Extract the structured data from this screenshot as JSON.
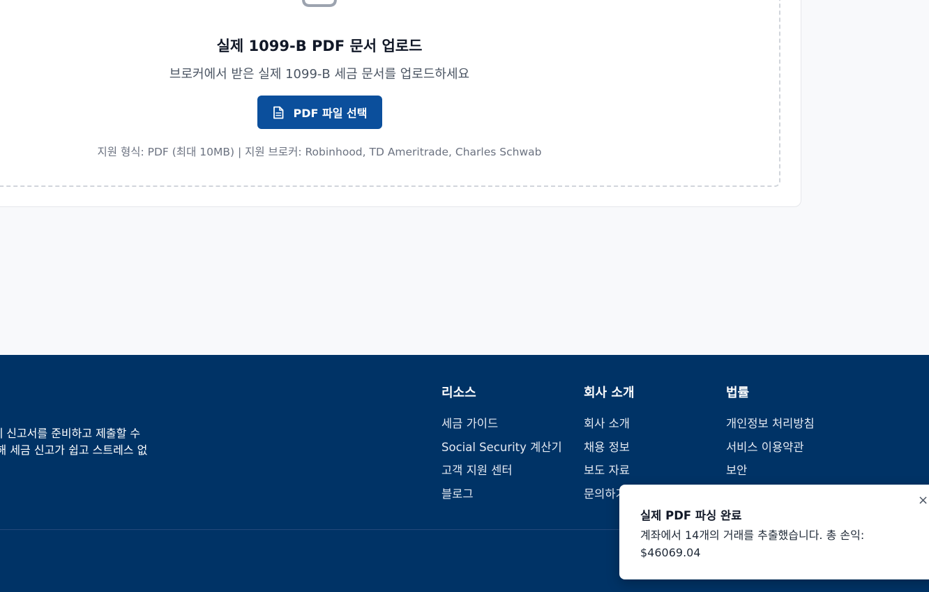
{
  "upload": {
    "title": "실제 1099-B PDF 문서 업로드",
    "subtitle": "브로커에서 받은 실제 1099-B 세금 문서를 업로드하세요",
    "button_label": "PDF 파일 선택",
    "formats": "지원 형식: PDF (최대 10MB) | 지원 브로커: Robinhood, TD Ameritrade, Charles Schwab",
    "icon": "upload-icon",
    "button_icon": "document-icon",
    "accent": "#0b4f9c"
  },
  "footer": {
    "about_lines": [
      "연방세 신고서를 준비하고 제출할 수",
      "을 통해 세금 신고가 쉽고 스트레스 없"
    ],
    "background": "#003366",
    "columns": [
      {
        "heading": "리소스",
        "links": [
          "세금 가이드",
          "Social Security 계산기",
          "고객 지원 센터",
          "블로그"
        ]
      },
      {
        "heading": "회사 소개",
        "links": [
          "회사 소개",
          "채용 정보",
          "보도 자료",
          "문의하기"
        ]
      },
      {
        "heading": "법률",
        "links": [
          "개인정보 처리방침",
          "서비스 이용약관",
          "보안"
        ]
      }
    ]
  },
  "toast": {
    "title": "실제 PDF 파싱 완료",
    "message": "계좌에서 14개의 거래를 추출했습니다. 총 손익: $46069.04",
    "close_symbol": "×"
  }
}
